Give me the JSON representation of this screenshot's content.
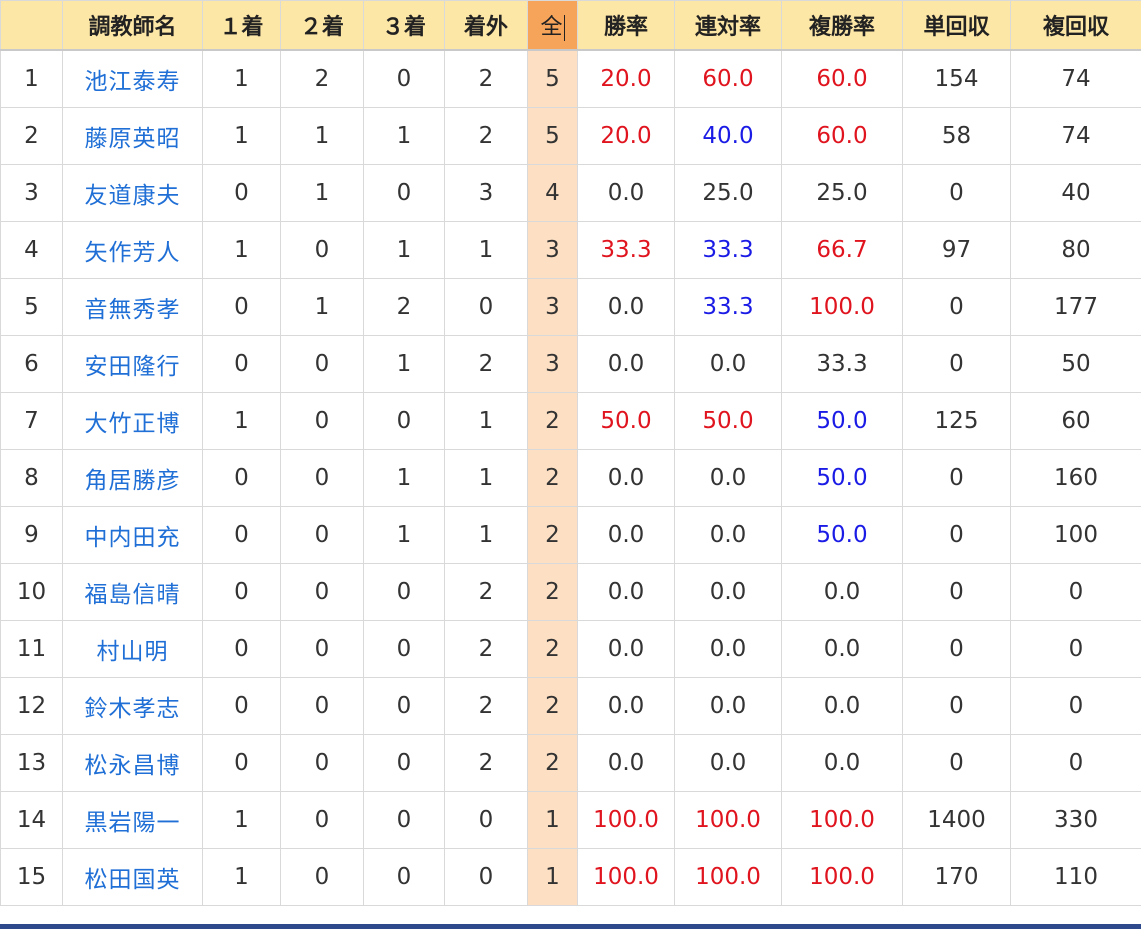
{
  "table": {
    "columns": [
      "",
      "調教師名",
      "１着",
      "２着",
      "３着",
      "着外",
      "全",
      "勝率",
      "連対率",
      "複勝率",
      "単回収",
      "複回収"
    ],
    "rows": [
      {
        "rank": "1",
        "name": "池江泰寿",
        "first": "1",
        "second": "2",
        "third": "0",
        "out": "2",
        "total": "5",
        "win_rate": "20.0",
        "quinella_rate": "60.0",
        "place_rate": "60.0",
        "win_return": "154",
        "place_return": "74",
        "colors": [
          "red",
          "red",
          "red"
        ]
      },
      {
        "rank": "2",
        "name": "藤原英昭",
        "first": "1",
        "second": "1",
        "third": "1",
        "out": "2",
        "total": "5",
        "win_rate": "20.0",
        "quinella_rate": "40.0",
        "place_rate": "60.0",
        "win_return": "58",
        "place_return": "74",
        "colors": [
          "red",
          "blue",
          "red"
        ]
      },
      {
        "rank": "3",
        "name": "友道康夫",
        "first": "0",
        "second": "1",
        "third": "0",
        "out": "3",
        "total": "4",
        "win_rate": "0.0",
        "quinella_rate": "25.0",
        "place_rate": "25.0",
        "win_return": "0",
        "place_return": "40",
        "colors": [
          "",
          "",
          ""
        ]
      },
      {
        "rank": "4",
        "name": "矢作芳人",
        "first": "1",
        "second": "0",
        "third": "1",
        "out": "1",
        "total": "3",
        "win_rate": "33.3",
        "quinella_rate": "33.3",
        "place_rate": "66.7",
        "win_return": "97",
        "place_return": "80",
        "colors": [
          "red",
          "blue",
          "red"
        ]
      },
      {
        "rank": "5",
        "name": "音無秀孝",
        "first": "0",
        "second": "1",
        "third": "2",
        "out": "0",
        "total": "3",
        "win_rate": "0.0",
        "quinella_rate": "33.3",
        "place_rate": "100.0",
        "win_return": "0",
        "place_return": "177",
        "colors": [
          "",
          "blue",
          "red"
        ]
      },
      {
        "rank": "6",
        "name": "安田隆行",
        "first": "0",
        "second": "0",
        "third": "1",
        "out": "2",
        "total": "3",
        "win_rate": "0.0",
        "quinella_rate": "0.0",
        "place_rate": "33.3",
        "win_return": "0",
        "place_return": "50",
        "colors": [
          "",
          "",
          ""
        ]
      },
      {
        "rank": "7",
        "name": "大竹正博",
        "first": "1",
        "second": "0",
        "third": "0",
        "out": "1",
        "total": "2",
        "win_rate": "50.0",
        "quinella_rate": "50.0",
        "place_rate": "50.0",
        "win_return": "125",
        "place_return": "60",
        "colors": [
          "red",
          "red",
          "blue"
        ]
      },
      {
        "rank": "8",
        "name": "角居勝彦",
        "first": "0",
        "second": "0",
        "third": "1",
        "out": "1",
        "total": "2",
        "win_rate": "0.0",
        "quinella_rate": "0.0",
        "place_rate": "50.0",
        "win_return": "0",
        "place_return": "160",
        "colors": [
          "",
          "",
          "blue"
        ]
      },
      {
        "rank": "9",
        "name": "中内田充",
        "first": "0",
        "second": "0",
        "third": "1",
        "out": "1",
        "total": "2",
        "win_rate": "0.0",
        "quinella_rate": "0.0",
        "place_rate": "50.0",
        "win_return": "0",
        "place_return": "100",
        "colors": [
          "",
          "",
          "blue"
        ]
      },
      {
        "rank": "10",
        "name": "福島信晴",
        "first": "0",
        "second": "0",
        "third": "0",
        "out": "2",
        "total": "2",
        "win_rate": "0.0",
        "quinella_rate": "0.0",
        "place_rate": "0.0",
        "win_return": "0",
        "place_return": "0",
        "colors": [
          "",
          "",
          ""
        ]
      },
      {
        "rank": "11",
        "name": "村山明",
        "first": "0",
        "second": "0",
        "third": "0",
        "out": "2",
        "total": "2",
        "win_rate": "0.0",
        "quinella_rate": "0.0",
        "place_rate": "0.0",
        "win_return": "0",
        "place_return": "0",
        "colors": [
          "",
          "",
          ""
        ]
      },
      {
        "rank": "12",
        "name": "鈴木孝志",
        "first": "0",
        "second": "0",
        "third": "0",
        "out": "2",
        "total": "2",
        "win_rate": "0.0",
        "quinella_rate": "0.0",
        "place_rate": "0.0",
        "win_return": "0",
        "place_return": "0",
        "colors": [
          "",
          "",
          ""
        ]
      },
      {
        "rank": "13",
        "name": "松永昌博",
        "first": "0",
        "second": "0",
        "third": "0",
        "out": "2",
        "total": "2",
        "win_rate": "0.0",
        "quinella_rate": "0.0",
        "place_rate": "0.0",
        "win_return": "0",
        "place_return": "0",
        "colors": [
          "",
          "",
          ""
        ]
      },
      {
        "rank": "14",
        "name": "黒岩陽一",
        "first": "1",
        "second": "0",
        "third": "0",
        "out": "0",
        "total": "1",
        "win_rate": "100.0",
        "quinella_rate": "100.0",
        "place_rate": "100.0",
        "win_return": "1400",
        "place_return": "330",
        "colors": [
          "red",
          "red",
          "red"
        ]
      },
      {
        "rank": "15",
        "name": "松田国英",
        "first": "1",
        "second": "0",
        "third": "0",
        "out": "0",
        "total": "1",
        "win_rate": "100.0",
        "quinella_rate": "100.0",
        "place_rate": "100.0",
        "win_return": "170",
        "place_return": "110",
        "colors": [
          "red",
          "red",
          "red"
        ]
      }
    ]
  },
  "colors": {
    "header_bg": "#fde7a6",
    "total_header_bg": "#f7a45b",
    "total_cell_bg": "#fde0c4",
    "link": "#1f6fd6",
    "high_rate": "#e0141e",
    "mid_rate": "#1b1be6"
  }
}
